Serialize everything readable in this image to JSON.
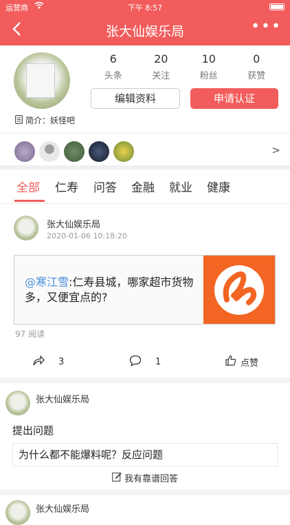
{
  "status": {
    "carrier": "运营商",
    "time": "下午 8:57"
  },
  "nav": {
    "title": "张大仙娱乐局"
  },
  "profile": {
    "stats": [
      {
        "num": "6",
        "label": "头条"
      },
      {
        "num": "20",
        "label": "关注"
      },
      {
        "num": "10",
        "label": "粉丝"
      },
      {
        "num": "0",
        "label": "获赞"
      }
    ],
    "edit_label": "编辑资料",
    "cert_label": "申请认证",
    "intro": "简介：妖怪吧"
  },
  "tabs": [
    "全部",
    "仁寿",
    "问答",
    "金融",
    "就业",
    "健康"
  ],
  "post": {
    "author": "张大仙娱乐局",
    "time": "2020-01-06 10:18:20",
    "mention": "@寒江雪",
    "text": ":仁寿县城，哪家超市货物多，又便宜点的?",
    "reads": "97 阅读",
    "shares": "3",
    "comments": "1",
    "like_label": "点赞"
  },
  "question": {
    "author": "张大仙娱乐局",
    "title": "提出问题",
    "body": "为什么都不能爆料呢？反应问题",
    "answer_label": "我有靠谱回答"
  },
  "post3": {
    "author": "张大仙娱乐局"
  },
  "colors": {
    "accent": "#f25c5c",
    "link": "#4a90d9",
    "logo_bg": "#f26522"
  }
}
